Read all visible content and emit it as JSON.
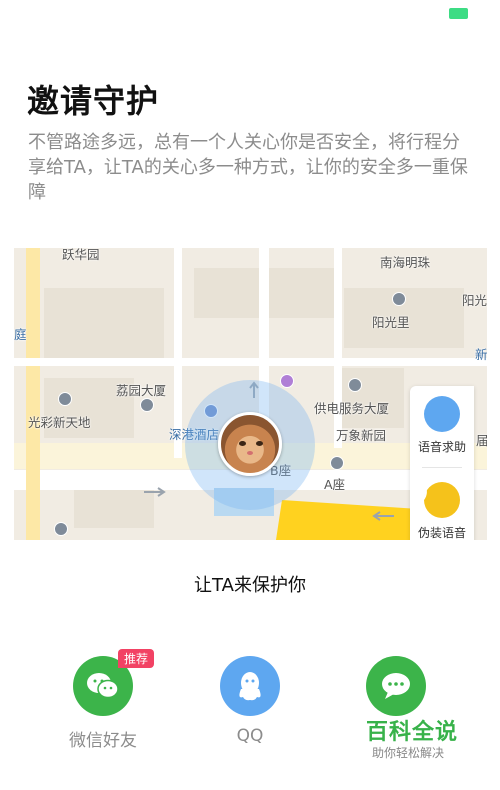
{
  "status_bar": {
    "battery_color": "#3ddc84"
  },
  "page": {
    "title": "邀请守护",
    "description": "不管路途多远，总有一个人关心你是否安全，将行程分享给TA，让TA的关心多一种方式，让你的安全多一重保障"
  },
  "map": {
    "labels": {
      "top_left": "跃华园",
      "left_edge": "庭",
      "nanhai": "南海明珠",
      "yangguang_right": "阳光",
      "yangguangli": "阳光里",
      "xin": "新",
      "liyuan": "荔园大厦",
      "guangcai": "光彩新天地",
      "hotel": "深港酒店",
      "supply": "供电服务大厦",
      "wanxiang": "万象新园",
      "fu": "届",
      "b_seat": "B座",
      "a_seat": "A座"
    },
    "side_panel": {
      "voice_help": "语音求助",
      "fake_voice": "伪装语音"
    }
  },
  "invite": {
    "subtitle": "让TA来保护你",
    "share": [
      {
        "label": "微信好友",
        "badge": "推荐",
        "icon": "wechat-icon",
        "color": "#3cb44a"
      },
      {
        "label": "QQ",
        "icon": "qq-icon",
        "color": "#5ea7f0"
      },
      {
        "label": "",
        "icon": "message-icon",
        "color": "#3cb44a"
      }
    ]
  },
  "watermark": {
    "title": "百科全说",
    "subtitle": "助你轻松解决"
  }
}
